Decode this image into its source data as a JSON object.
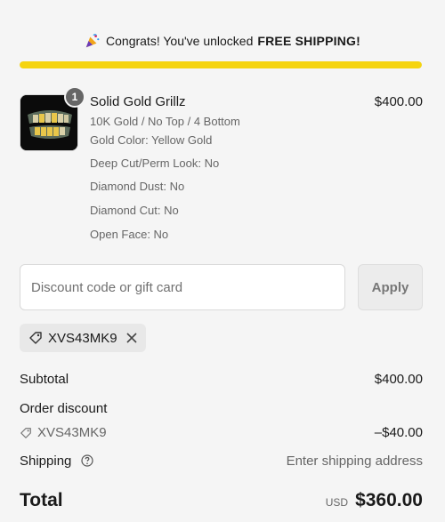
{
  "banner": {
    "icon": "party-popper-icon",
    "text": "Congrats! You've unlocked",
    "highlight": "FREE SHIPPING!",
    "progress_percent": 100,
    "progress_color": "#f5d40f"
  },
  "item": {
    "quantity": "1",
    "title": "Solid Gold Grillz",
    "price": "$400.00",
    "options": [
      "10K Gold / No Top / 4 Bottom",
      "Gold Color: Yellow Gold",
      "Deep Cut/Perm Look: No",
      "Diamond Dust: No",
      "Diamond Cut: No",
      "Open Face: No"
    ]
  },
  "discount": {
    "placeholder": "Discount code or gift card",
    "value": "",
    "apply_label": "Apply",
    "applied_code": "XVS43MK9"
  },
  "summary": {
    "subtotal_label": "Subtotal",
    "subtotal_value": "$400.00",
    "order_discount_label": "Order discount",
    "discount_code": "XVS43MK9",
    "discount_value": "–$40.00",
    "shipping_label": "Shipping",
    "shipping_value": "Enter shipping address",
    "total_label": "Total",
    "total_currency": "USD",
    "total_value": "$360.00"
  }
}
